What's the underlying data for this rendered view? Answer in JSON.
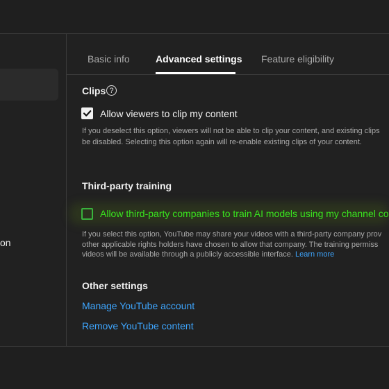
{
  "left_nav": {
    "partial_label": "on"
  },
  "tabs": [
    {
      "label": "Basic info"
    },
    {
      "label": "Advanced settings"
    },
    {
      "label": "Feature eligibility"
    }
  ],
  "clips": {
    "title": "Clips",
    "help_icon": "?",
    "checkbox_label": "Allow viewers to clip my content",
    "checked": true,
    "desc_line1": "If you deselect this option, viewers will not be able to clip your content, and existing clips",
    "desc_line2": "be disabled. Selecting this option again will re-enable existing clips of your content."
  },
  "training": {
    "title": "Third-party training",
    "checkbox_label": "Allow third-party companies to train AI models using my channel co",
    "checked": false,
    "desc_line1": "If you select this option, YouTube may share your videos with a third-party company prov",
    "desc_line2": "other applicable rights holders have chosen to allow that company. The training permiss",
    "desc_line3": "videos will be available through a publicly accessible interface.",
    "learn_more": "Learn more"
  },
  "other": {
    "title": "Other settings",
    "link1": "Manage YouTube account",
    "link2": "Remove YouTube content"
  },
  "colors": {
    "background": "#212121",
    "link": "#3ea6ff",
    "highlight_text": "#39e51f"
  }
}
